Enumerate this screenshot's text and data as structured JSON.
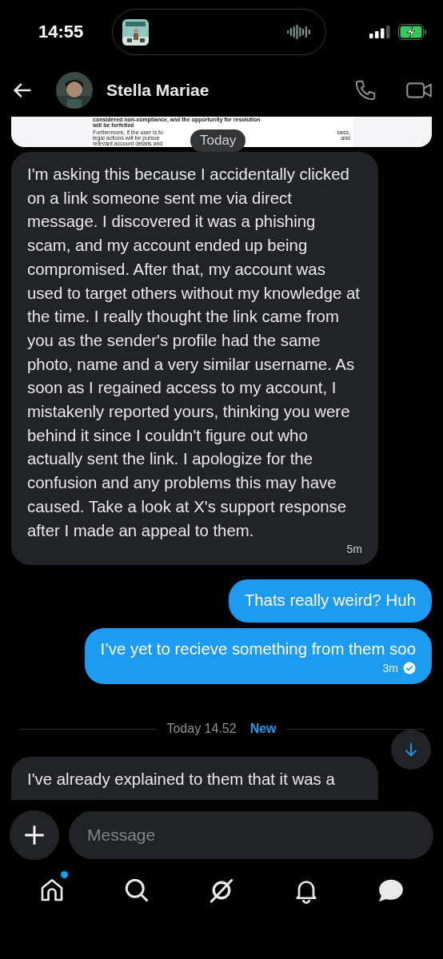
{
  "status_bar": {
    "time": "14:55"
  },
  "header": {
    "name": "Stella Mariae"
  },
  "attachment": {
    "lines": [
      "considered non-compliance, and the opportunity for resolution",
      "will be forfeited"
    ],
    "fragments": [
      {
        "left": "Furthermore, if the user is fo",
        "right": "cess,"
      },
      {
        "left": "legal actions will be pursue",
        "right": "and"
      },
      {
        "left": "relevant account details and"
      }
    ]
  },
  "date_pill": "Today",
  "messages": [
    {
      "kind": "incoming",
      "text": "I'm asking this because I accidentally clicked on a link someone sent me via direct message. I discovered it was a phishing scam, and my account ended up being compromised. After that, my account was used to target others without my knowledge at the time. I really thought the link came from you as the sender's profile had the same photo, name and a very similar username. As soon as I regained access to my account, I mistakenly reported yours, thinking you were behind it since I couldn't figure out who actually sent the link. I apologize for the confusion and any problems this may have caused. Take a look at X's support response after I made an appeal to them.",
      "time": "5m",
      "read": false
    },
    {
      "kind": "outgoing",
      "text": "Thats really weird? Huh",
      "read": false
    },
    {
      "kind": "outgoing",
      "text": "I’ve yet to recieve something from them soo",
      "time": "3m",
      "read": true
    }
  ],
  "divider": {
    "text": "Today 14.52",
    "badge": "New"
  },
  "partial_message": {
    "text": "I've already explained to them that it was a"
  },
  "composer": {
    "placeholder": "Message"
  },
  "nav": [
    {
      "kind": "home",
      "selected": false,
      "badge": true
    },
    {
      "kind": "search",
      "selected": false,
      "badge": false
    },
    {
      "kind": "grok",
      "selected": false,
      "badge": false
    },
    {
      "kind": "bell",
      "selected": false,
      "badge": false
    },
    {
      "kind": "messages",
      "selected": true,
      "badge": false
    }
  ]
}
